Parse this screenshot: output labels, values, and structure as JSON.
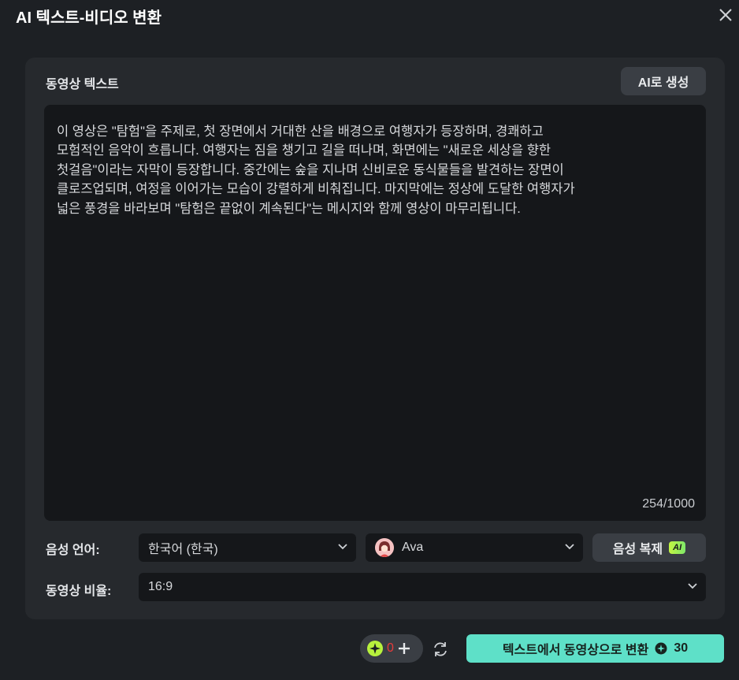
{
  "dialog": {
    "title": "AI 텍스트-비디오 변환"
  },
  "panel": {
    "text_label": "동영상 텍스트",
    "ai_generate_label": "AI로 생성",
    "text_lines": [
      "이 영상은 \"탐험\"을 주제로, 첫 장면에서 거대한 산을 배경으로 여행자가 등장하며, 경쾌하고",
      "모험적인 음악이 흐릅니다. 여행자는 짐을 챙기고 길을 떠나며, 화면에는 \"새로운 세상을 향한",
      "첫걸음\"이라는 자막이 등장합니다. 중간에는 숲을 지나며 신비로운 동식물들을 발견하는 장면이",
      "클로즈업되며, 여정을 이어가는 모습이 강렬하게 비춰집니다. 마지막에는 정상에 도달한 여행자가",
      "넓은 풍경을 바라보며 \"탐험은 끝없이 계속된다\"는 메시지와 함께 영상이 마무리됩니다."
    ],
    "char_count": "254/1000",
    "voice_language_label": "음성 언어:",
    "voice_language_value": "한국어 (한국)",
    "voice_name": "Ava",
    "voice_clone_label": "음성 복제",
    "ai_badge": "AI",
    "aspect_ratio_label": "동영상 비율:",
    "aspect_ratio_value": "16:9"
  },
  "footer": {
    "credits_value": "0",
    "convert_label": "텍스트에서 동영상으로 변환",
    "convert_cost": "30"
  },
  "colors": {
    "accent": "#5ee0c8",
    "badge": "#c4f542",
    "credits_alert": "#e83b3b"
  }
}
